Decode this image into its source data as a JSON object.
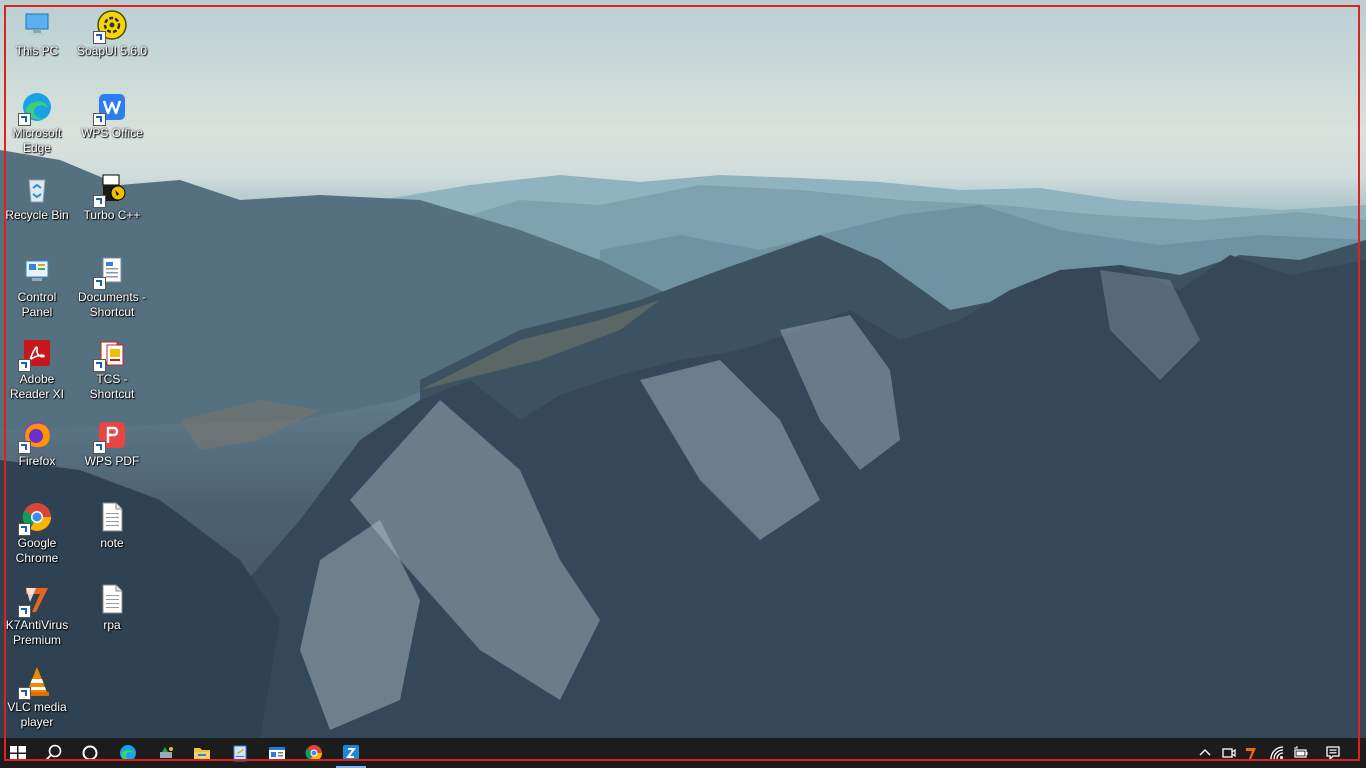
{
  "desktop": {
    "icons": [
      {
        "label": "This PC",
        "icon": "this-pc-icon"
      },
      {
        "label": "SoapUI 5.6.0",
        "icon": "soapui-icon"
      },
      {
        "label": "Microsoft Edge",
        "icon": "edge-icon"
      },
      {
        "label": "WPS Office",
        "icon": "wps-office-icon"
      },
      {
        "label": "Recycle Bin",
        "icon": "recycle-bin-icon"
      },
      {
        "label": "Turbo C++",
        "icon": "turbo-cpp-icon"
      },
      {
        "label": "Control Panel",
        "icon": "control-panel-icon"
      },
      {
        "label": "Documents - Shortcut",
        "icon": "documents-shortcut-icon"
      },
      {
        "label": "Adobe Reader XI",
        "icon": "adobe-reader-icon"
      },
      {
        "label": "TCS - Shortcut",
        "icon": "tcs-shortcut-icon"
      },
      {
        "label": "Firefox",
        "icon": "firefox-icon"
      },
      {
        "label": "WPS PDF",
        "icon": "wps-pdf-icon"
      },
      {
        "label": "Google Chrome",
        "icon": "chrome-icon"
      },
      {
        "label": "note",
        "icon": "text-file-icon"
      },
      {
        "label": "K7AntiVirus Premium",
        "icon": "k7-antivirus-icon"
      },
      {
        "label": "rpa",
        "icon": "text-file-icon"
      },
      {
        "label": "VLC media player",
        "icon": "vlc-icon"
      }
    ]
  },
  "taskbar": {
    "items": [
      "start-icon",
      "search-icon",
      "cortana-icon",
      "edge-icon",
      "pinned-app-icon",
      "file-explorer-icon",
      "notepad-icon",
      "news-icon",
      "chrome-icon",
      "active-app-icon"
    ],
    "tray": [
      "chevron-up-icon",
      "meet-now-icon",
      "k7-tray-icon",
      "network-icon",
      "battery-icon",
      "notifications-icon"
    ]
  },
  "colors": {
    "taskbar": "#1c1c1c",
    "accent": "#7fb6ff",
    "frame": "#e0201e"
  }
}
